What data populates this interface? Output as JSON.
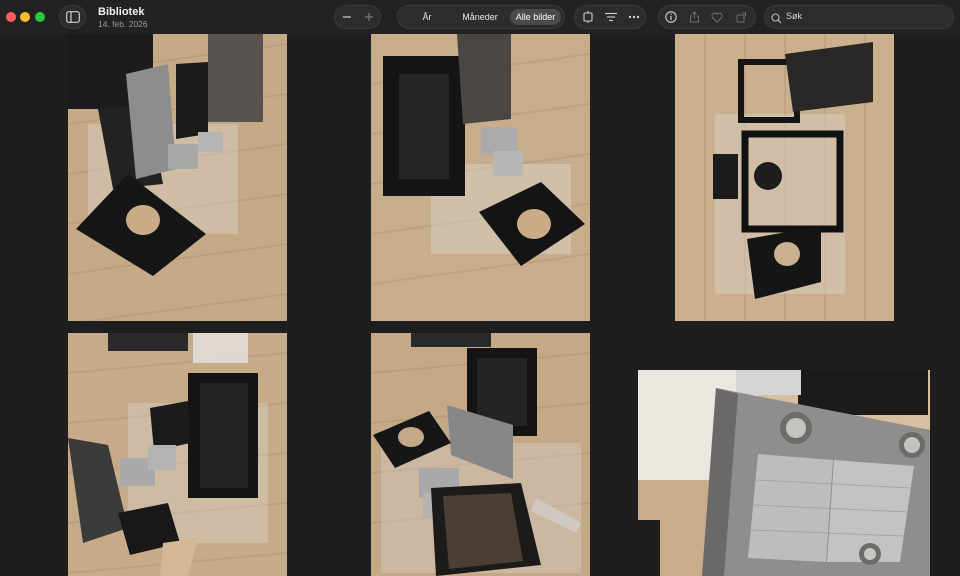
{
  "window": {
    "title": "Bibliotek",
    "date": "14. feb. 2026"
  },
  "toolbar": {
    "view_modes": [
      {
        "label": "År",
        "active": false
      },
      {
        "label": "Måneder",
        "active": false
      },
      {
        "label": "Alle bilder",
        "active": true
      }
    ],
    "search_placeholder": "Søk",
    "icons": [
      "sidebar-toggle-icon",
      "zoom-out-icon",
      "zoom-in-icon",
      "slideshow-icon",
      "filter-icon",
      "more-icon",
      "info-icon",
      "share-icon",
      "heart-icon",
      "rotate-icon",
      "search-icon"
    ]
  },
  "photos": [
    {
      "subject": "cooker hood parts on wooden floor"
    },
    {
      "subject": "cooker hood chimney box and filters"
    },
    {
      "subject": "cooker hood frame top view"
    },
    {
      "subject": "cooker hood chimney standing"
    },
    {
      "subject": "cooker hood assembly on plastic sheet"
    },
    {
      "subject": "cooker hood stainless steel close-up with filters"
    }
  ],
  "colors": {
    "background": "#1e1e1e",
    "toolbar": "#222222",
    "floor": "#c9ad8c",
    "wall": "#e8e4de"
  }
}
